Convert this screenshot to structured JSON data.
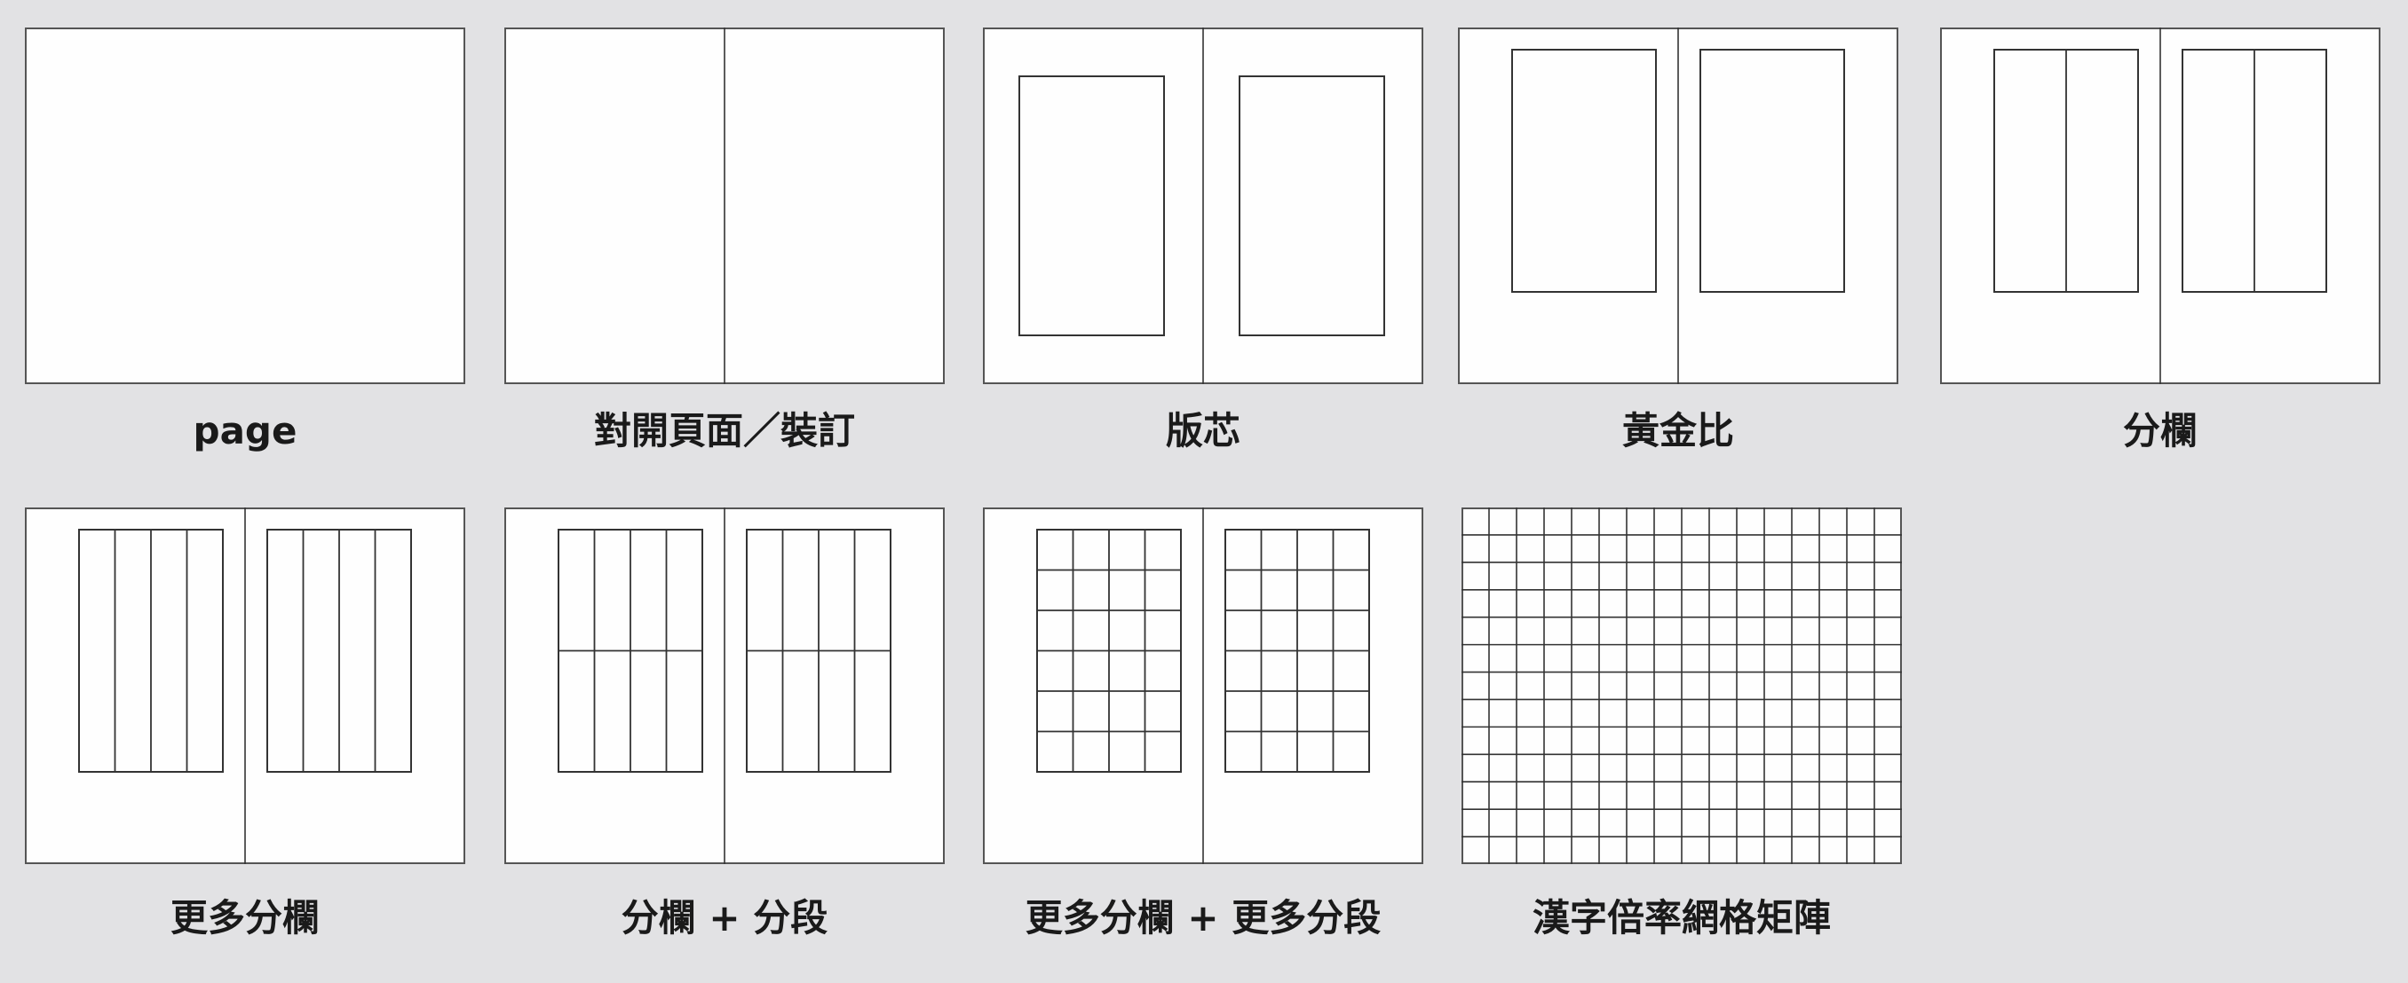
{
  "background_color": "#e2e2e4",
  "panel_color": "#fefefe",
  "line_color": "#333333",
  "panels": [
    {
      "id": "page",
      "caption": "page",
      "gutter": false,
      "blocks": 0,
      "cols": 0,
      "rows": 0,
      "full_grid": false
    },
    {
      "id": "spread",
      "caption": "對開頁面／裝訂",
      "gutter": true,
      "blocks": 0,
      "cols": 0,
      "rows": 0,
      "full_grid": false
    },
    {
      "id": "type-area",
      "caption": "版芯",
      "gutter": true,
      "blocks": 2,
      "cols": 1,
      "rows": 1,
      "full_grid": false
    },
    {
      "id": "golden-ratio",
      "caption": "黃金比",
      "gutter": true,
      "blocks": 2,
      "cols": 1,
      "rows": 1,
      "full_grid": false
    },
    {
      "id": "columns",
      "caption": "分欄",
      "gutter": true,
      "blocks": 2,
      "cols": 2,
      "rows": 1,
      "full_grid": false
    },
    {
      "id": "more-columns",
      "caption": "更多分欄",
      "gutter": true,
      "blocks": 2,
      "cols": 4,
      "rows": 1,
      "full_grid": false
    },
    {
      "id": "columns-rows",
      "caption": "分欄 + 分段",
      "gutter": true,
      "blocks": 2,
      "cols": 4,
      "rows": 2,
      "full_grid": false
    },
    {
      "id": "more-columns-rows",
      "caption": "更多分欄 + 更多分段",
      "gutter": true,
      "blocks": 2,
      "cols": 4,
      "rows": 6,
      "full_grid": false
    },
    {
      "id": "hanzi-grid",
      "caption": "漢字倍率網格矩陣",
      "gutter": false,
      "blocks": 0,
      "cols": 16,
      "rows": 13,
      "full_grid": true
    }
  ]
}
